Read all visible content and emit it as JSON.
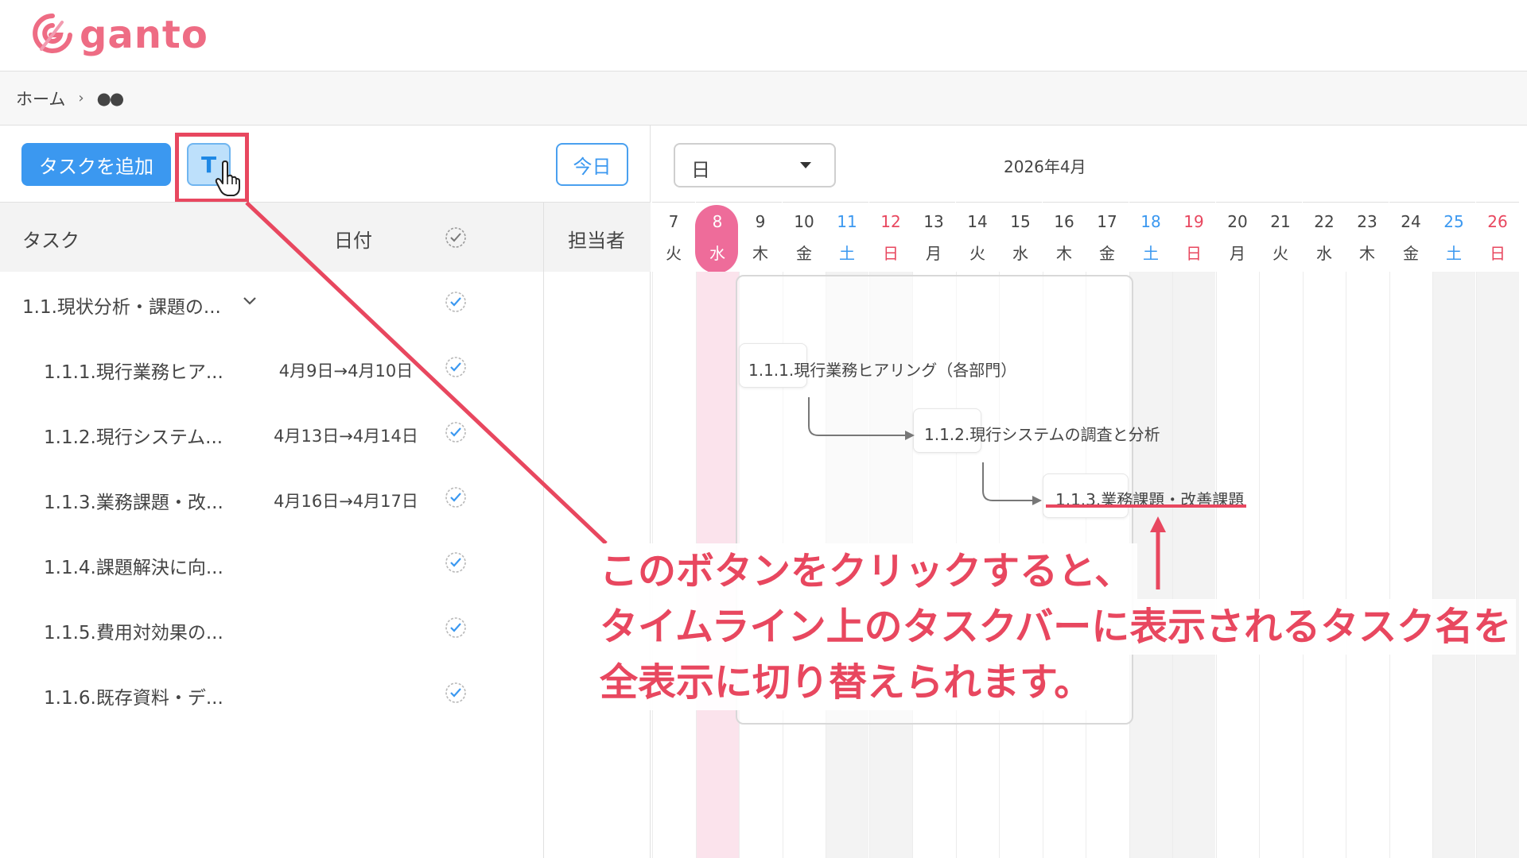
{
  "app": {
    "logo_text": "ganto",
    "brand_color": "#ee6c84",
    "accent_color": "#3b98f0",
    "annotation_color": "#e8475f"
  },
  "breadcrumb": {
    "home": "ホーム",
    "separator": "›",
    "current": "●●"
  },
  "toolbar": {
    "add_task_label": "タスクを追加",
    "toggle_label": "T",
    "today_label": "今日"
  },
  "table_header": {
    "task": "タスク",
    "date": "日付",
    "assignee": "担当者"
  },
  "tasks": [
    {
      "name": "1.1.現状分析・課題の...",
      "date": "",
      "level": 0,
      "done": true,
      "expanded": true
    },
    {
      "name": "1.1.1.現行業務ヒア...",
      "date": "4月9日→4月10日",
      "level": 1,
      "done": true
    },
    {
      "name": "1.1.2.現行システム...",
      "date": "4月13日→4月14日",
      "level": 1,
      "done": true
    },
    {
      "name": "1.1.3.業務課題・改...",
      "date": "4月16日→4月17日",
      "level": 1,
      "done": true
    },
    {
      "name": "1.1.4.課題解決に向...",
      "date": "",
      "level": 1,
      "done": true
    },
    {
      "name": "1.1.5.費用対効果の...",
      "date": "",
      "level": 1,
      "done": true
    },
    {
      "name": "1.1.6.既存資料・デ...",
      "date": "",
      "level": 1,
      "done": true
    }
  ],
  "timeline": {
    "scale": "日",
    "month": "2026年4月",
    "days": [
      {
        "num": "7",
        "wd": "火",
        "type": "weekday"
      },
      {
        "num": "8",
        "wd": "水",
        "type": "today"
      },
      {
        "num": "9",
        "wd": "木",
        "type": "weekday"
      },
      {
        "num": "10",
        "wd": "金",
        "type": "weekday"
      },
      {
        "num": "11",
        "wd": "土",
        "type": "sat"
      },
      {
        "num": "12",
        "wd": "日",
        "type": "sun"
      },
      {
        "num": "13",
        "wd": "月",
        "type": "weekday"
      },
      {
        "num": "14",
        "wd": "火",
        "type": "weekday"
      },
      {
        "num": "15",
        "wd": "水",
        "type": "weekday"
      },
      {
        "num": "16",
        "wd": "木",
        "type": "weekday"
      },
      {
        "num": "17",
        "wd": "金",
        "type": "weekday"
      },
      {
        "num": "18",
        "wd": "土",
        "type": "sat"
      },
      {
        "num": "19",
        "wd": "日",
        "type": "sun"
      },
      {
        "num": "20",
        "wd": "月",
        "type": "weekday"
      },
      {
        "num": "21",
        "wd": "火",
        "type": "weekday"
      },
      {
        "num": "22",
        "wd": "水",
        "type": "weekday"
      },
      {
        "num": "23",
        "wd": "木",
        "type": "weekday"
      },
      {
        "num": "24",
        "wd": "金",
        "type": "weekday"
      },
      {
        "num": "25",
        "wd": "土",
        "type": "sat"
      },
      {
        "num": "26",
        "wd": "日",
        "type": "sun"
      }
    ],
    "bars": [
      {
        "label": "1.1.1.現行業務ヒアリング（各部門）"
      },
      {
        "label": "1.1.2.現行システムの調査と分析"
      },
      {
        "label": "1.1.3.業務課題・改善課題"
      }
    ]
  },
  "annotation": {
    "line1": "このボタンをクリックすると、",
    "line2": "タイムライン上のタスクバーに表示されるタスク名を",
    "line3": "全表示に切り替えられます。"
  }
}
